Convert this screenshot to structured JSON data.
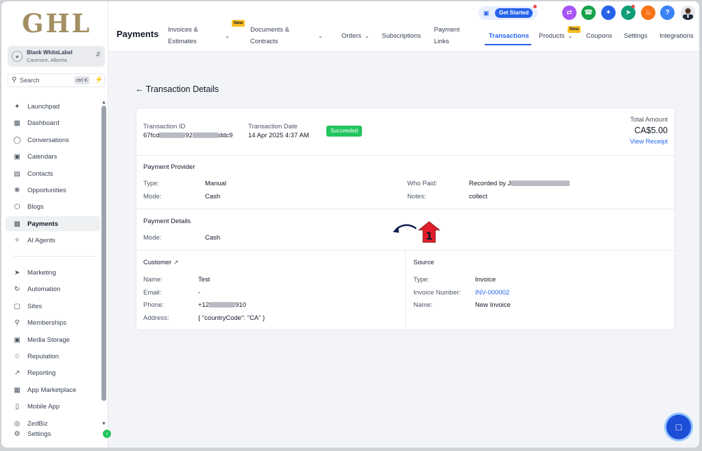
{
  "brand": {
    "logo_text": "GHL"
  },
  "account": {
    "name": "Blank WhiteLabel",
    "location": "Canmore, Alberta"
  },
  "search": {
    "label": "Search",
    "shortcut": "ctrl K"
  },
  "sidebar": {
    "items": [
      {
        "label": "Launchpad",
        "icon": "rocket-icon"
      },
      {
        "label": "Dashboard",
        "icon": "grid-icon"
      },
      {
        "label": "Conversations",
        "icon": "chat-icon"
      },
      {
        "label": "Calendars",
        "icon": "calendar-icon"
      },
      {
        "label": "Contacts",
        "icon": "contacts-icon"
      },
      {
        "label": "Opportunities",
        "icon": "opportunities-icon"
      },
      {
        "label": "Blogs",
        "icon": "cube-icon"
      },
      {
        "label": "Payments",
        "icon": "receipt-icon",
        "active": true
      },
      {
        "label": "AI Agents",
        "icon": "sparkle-icon"
      },
      {
        "label": "Marketing",
        "icon": "send-icon"
      },
      {
        "label": "Automation",
        "icon": "automation-icon"
      },
      {
        "label": "Sites",
        "icon": "sites-icon"
      },
      {
        "label": "Memberships",
        "icon": "memberships-icon"
      },
      {
        "label": "Media Storage",
        "icon": "image-icon"
      },
      {
        "label": "Reputation",
        "icon": "star-icon"
      },
      {
        "label": "Reporting",
        "icon": "trend-icon"
      },
      {
        "label": "App Marketplace",
        "icon": "apps-icon"
      },
      {
        "label": "Mobile App",
        "icon": "mobile-icon"
      },
      {
        "label": "ZedBiz",
        "icon": "zedbiz-icon"
      },
      {
        "label": "Settings",
        "icon": "gear-icon"
      }
    ]
  },
  "header": {
    "page_title": "Payments",
    "tabs": [
      {
        "label": "Invoices & Estimates",
        "badge": "New"
      },
      {
        "label": "Documents & Contracts"
      },
      {
        "label": "Orders"
      },
      {
        "label": "Subscriptions"
      },
      {
        "label": "Payment Links"
      },
      {
        "label": "Transactions",
        "active": true
      },
      {
        "label": "Products",
        "badge": "New"
      },
      {
        "label": "Coupons"
      },
      {
        "label": "Settings"
      },
      {
        "label": "Integrations"
      }
    ],
    "get_started": "Get Started",
    "help_label": "?"
  },
  "colors": {
    "accent": "#2563eb",
    "success": "#22c55e",
    "brand_gold": "#a38e62"
  },
  "transaction": {
    "back_title": "Transaction Details",
    "id_label": "Transaction ID",
    "id_prefix": "67fcd",
    "id_mid": "92",
    "id_suffix": "ddc9",
    "date_label": "Transaction Date",
    "date_value": "14 Apr 2025 4:37 AM",
    "status": "Succeeded",
    "total_label": "Total Amount",
    "total_value": "CA$5.00",
    "view_receipt": "View Receipt"
  },
  "provider": {
    "title": "Payment Provider",
    "type_label": "Type:",
    "type_value": "Manual",
    "mode_label": "Mode:",
    "mode_value": "Cash",
    "who_label": "Who Paid:",
    "who_value": "Recorded by J",
    "notes_label": "Notes:",
    "notes_value": "collect"
  },
  "payment_details": {
    "title": "Payment Details",
    "mode_label": "Mode:",
    "mode_value": "Cash",
    "annotation_number": "1"
  },
  "customer": {
    "title": "Customer",
    "name_label": "Name:",
    "name_value": "Test",
    "email_label": "Email:",
    "email_value": "-",
    "phone_label": "Phone:",
    "phone_prefix": "+12",
    "phone_suffix": "910",
    "address_label": "Address:",
    "address_value": "{ \"countryCode\": \"CA\" }"
  },
  "source": {
    "title": "Source",
    "type_label": "Type:",
    "type_value": "Invoice",
    "number_label": "Invoice Number:",
    "number_value": "INV-000002",
    "name_label": "Name:",
    "name_value": "New Invoice"
  }
}
